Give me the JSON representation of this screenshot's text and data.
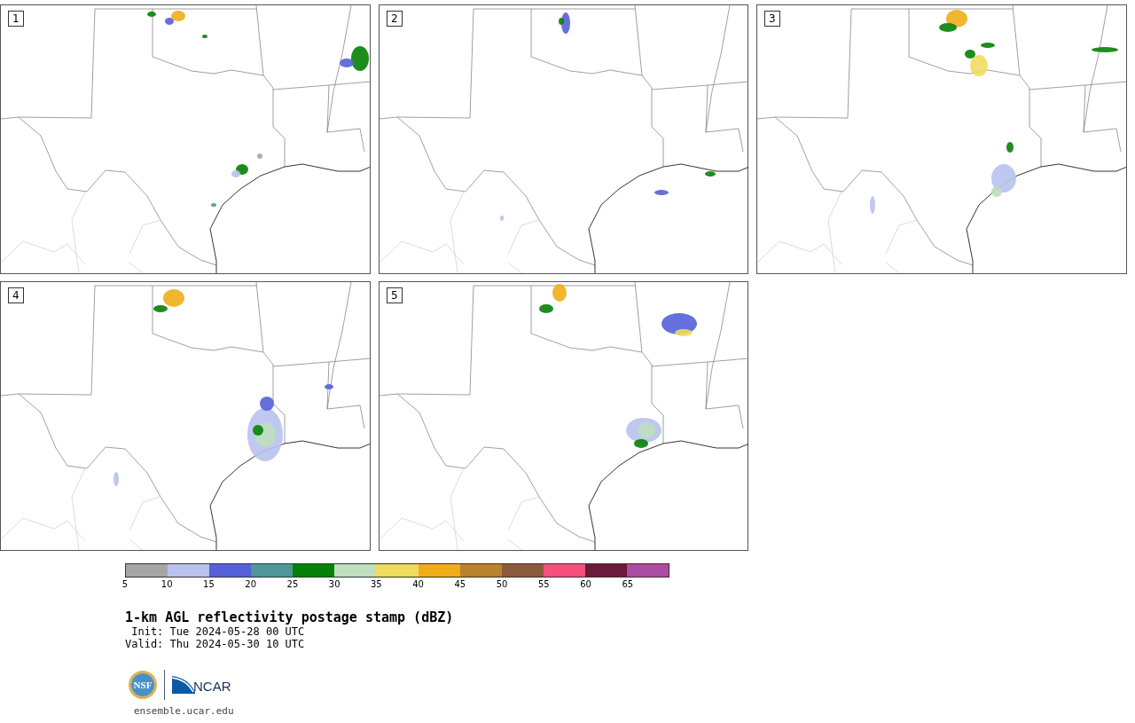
{
  "panels": [
    {
      "label": "1"
    },
    {
      "label": "2"
    },
    {
      "label": "3"
    },
    {
      "label": "4"
    },
    {
      "label": "5"
    }
  ],
  "colorbar": {
    "segments": [
      {
        "color": "#a5a5a5"
      },
      {
        "color": "#b8c2ec"
      },
      {
        "color": "#5461d8"
      },
      {
        "color": "#4f9699"
      },
      {
        "color": "#058105"
      },
      {
        "color": "#bfdfbf"
      },
      {
        "color": "#efdb5f"
      },
      {
        "color": "#f0ad1a"
      },
      {
        "color": "#b8822f"
      },
      {
        "color": "#8b5a3e"
      },
      {
        "color": "#f5507c"
      },
      {
        "color": "#6a1a3a"
      },
      {
        "color": "#ad4ca3"
      }
    ],
    "ticks": [
      "5",
      "10",
      "15",
      "20",
      "25",
      "30",
      "35",
      "40",
      "45",
      "50",
      "55",
      "60",
      "65"
    ]
  },
  "title": "1-km AGL reflectivity postage stamp (dBZ)",
  "init": " Init: Tue 2024-05-28 00 UTC",
  "valid": "Valid: Thu 2024-05-30 10 UTC",
  "logos": {
    "nsf": "NSF",
    "ncar": "NCAR"
  },
  "url": "ensemble.ucar.edu"
}
